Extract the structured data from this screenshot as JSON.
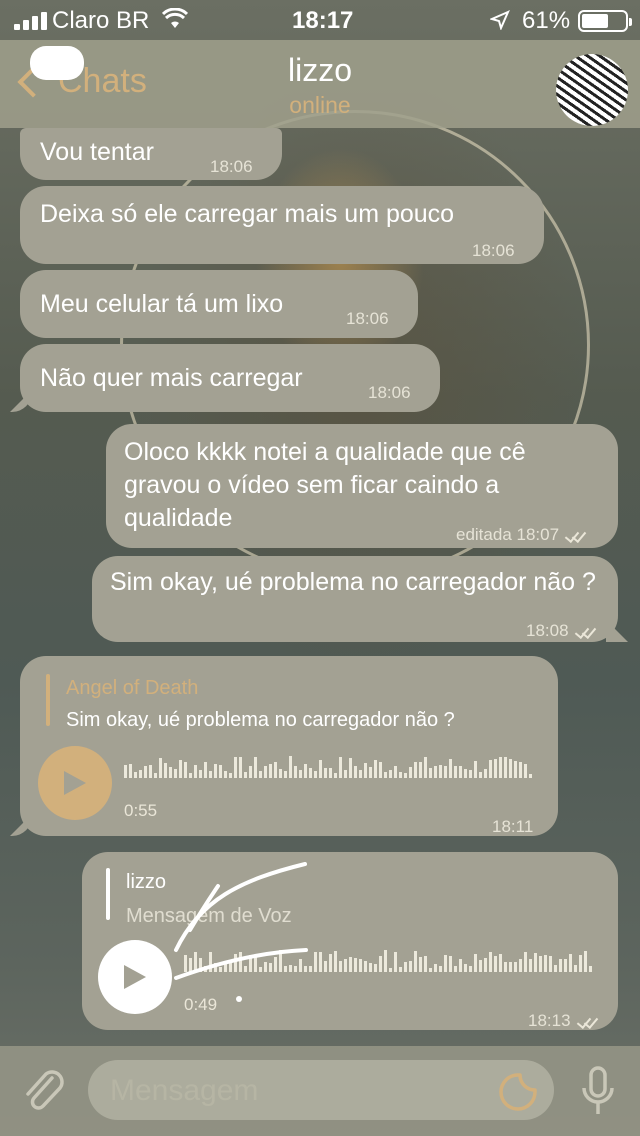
{
  "status_bar": {
    "carrier": "Claro BR",
    "time": "18:17",
    "battery": "61%"
  },
  "nav": {
    "back_label": "Chats",
    "title": "lizzo",
    "subtitle": "online"
  },
  "messages": [
    {
      "text": "Vou tentar",
      "time": "18:06"
    },
    {
      "text": "Deixa só ele carregar mais um pouco",
      "time": "18:06"
    },
    {
      "text": "Meu celular tá um lixo",
      "time": "18:06"
    },
    {
      "text": "Não quer mais carregar",
      "time": "18:06"
    },
    {
      "text": "Oloco kkkk notei a qualidade que cê gravou o vídeo sem ficar caindo a qualidade",
      "time": "editada 18:07"
    },
    {
      "text": "Sim okay, ué problema no carregador não ?",
      "time": "18:08"
    }
  ],
  "voice_in": {
    "reply_name": "Angel of Death",
    "reply_text": "Sim okay, ué problema no carregador não ?",
    "duration": "0:55",
    "time": "18:11"
  },
  "voice_out": {
    "reply_name": "lizzo",
    "reply_text": "Mensagem de Voz",
    "duration": "0:49",
    "time": "18:13"
  },
  "input": {
    "placeholder": "Mensagem"
  },
  "colors": {
    "accent": "#d2b07c",
    "bubble": "#a3a193"
  }
}
